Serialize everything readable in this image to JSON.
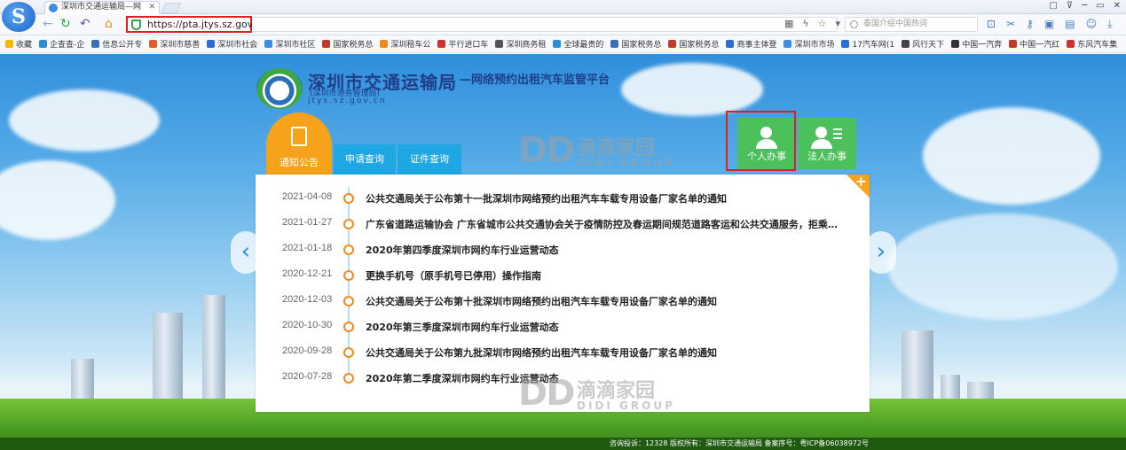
{
  "browser": {
    "tab_title": "深圳市交通运输局—网",
    "url": "https://pta.jtys.sz.gov.cn/",
    "search_placeholder": "泰国介绍中国热词",
    "back": "←",
    "refresh": "↻",
    "undo": "↶",
    "home": "⌂",
    "window_controls": [
      "▢",
      "⊽",
      "─",
      "▭",
      "✕"
    ]
  },
  "bookmarks": [
    {
      "label": "收藏",
      "color": "#f5b700"
    },
    {
      "label": "企查查-企",
      "color": "#2a8fd6"
    },
    {
      "label": "信息公开专",
      "color": "#3c6fb8"
    },
    {
      "label": "深圳市慈善",
      "color": "#e05a2a"
    },
    {
      "label": "深圳市社会",
      "color": "#2a6fd6"
    },
    {
      "label": "深圳市社区",
      "color": "#3c8de6"
    },
    {
      "label": "国家税务总",
      "color": "#c0392b"
    },
    {
      "label": "深圳租车公",
      "color": "#f08a1c"
    },
    {
      "label": "平行进口车",
      "color": "#d03030"
    },
    {
      "label": "深圳商务租",
      "color": "#555"
    },
    {
      "label": "全球最贵的",
      "color": "#2a8fd6"
    },
    {
      "label": "国家税务总",
      "color": "#3c6fb8"
    },
    {
      "label": "国家税务总",
      "color": "#c0392b"
    },
    {
      "label": "商事主体登",
      "color": "#2a6fd6"
    },
    {
      "label": "深圳市市场",
      "color": "#3c8de6"
    },
    {
      "label": "17汽车网(1",
      "color": "#2a6fd6"
    },
    {
      "label": "风行天下",
      "color": "#444"
    },
    {
      "label": "中国一汽奔",
      "color": "#333"
    },
    {
      "label": "中国一汽红",
      "color": "#c0392b"
    },
    {
      "label": "东风汽车集",
      "color": "#d03030"
    }
  ],
  "site": {
    "title": "深圳市交通运输局",
    "subtitle": "—网络预约出租汽车监管平台",
    "subtitle2": "(深圳市港务管理局)",
    "domain": "jtys.sz.gov.cn"
  },
  "tabs": {
    "notice": "通知公告",
    "apply_query": "申请查询",
    "cert_query": "证件查询"
  },
  "actions": {
    "personal": "个人办事",
    "corporate": "法人办事"
  },
  "notices": [
    {
      "date": "2021-04-08",
      "title": "公共交通局关于公布第十一批深圳市网络预约出租汽车车载专用设备厂家名单的通知"
    },
    {
      "date": "2021-01-27",
      "title": "广东省道路运输协会 广东省城市公共交通协会关于疫情防控及春运期间规范道路客运和公共交通服务，拒乘非法..."
    },
    {
      "date": "2021-01-18",
      "title": "2020年第四季度深圳市网约车行业运营动态"
    },
    {
      "date": "2020-12-21",
      "title": "更换手机号（原手机号已停用）操作指南"
    },
    {
      "date": "2020-12-03",
      "title": "公共交通局关于公布第十批深圳市网络预约出租汽车车载专用设备厂家名单的通知"
    },
    {
      "date": "2020-10-30",
      "title": "2020年第三季度深圳市网约车行业运营动态"
    },
    {
      "date": "2020-09-28",
      "title": "公共交通局关于公布第九批深圳市网络预约出租汽车车载专用设备厂家名单的通知"
    },
    {
      "date": "2020-07-28",
      "title": "2020年第二季度深圳市网约车行业运营动态"
    }
  ],
  "footer": "咨询投诉：12328  版权所有：深圳市交通运输局 备案序号：粤ICP备06038972号",
  "watermark": {
    "dd": "DD",
    "cn": "滴滴家园",
    "en": "DIDI GROUP"
  },
  "nav": {
    "prev": "‹",
    "next": "›",
    "more": "+"
  }
}
